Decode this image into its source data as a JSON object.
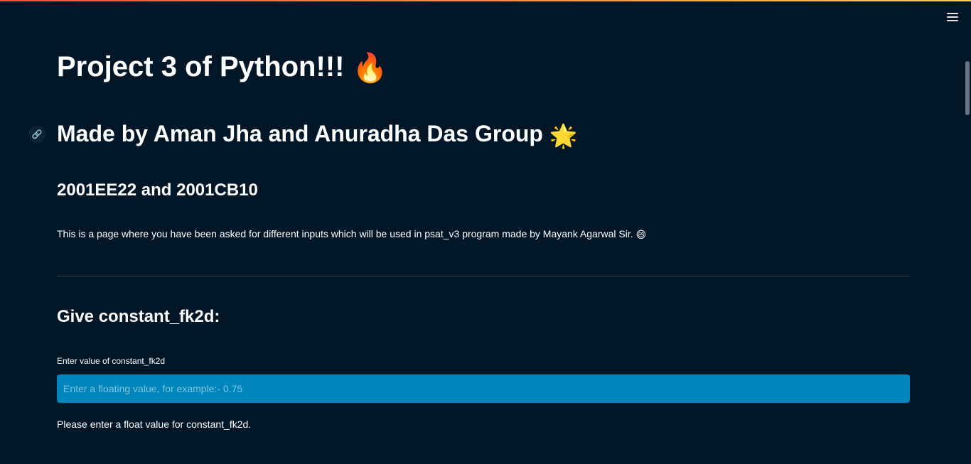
{
  "header": {
    "menu_icon": "hamburger-menu-icon"
  },
  "main": {
    "title": "Project 3 of Python!!!",
    "title_emoji": "🔥",
    "subtitle": "Made by Aman Jha and Anuradha Das Group",
    "subtitle_emoji": "🌟",
    "anchor_icon": "link-icon",
    "roll_numbers": "2001EE22 and 2001CB10",
    "description": "This is a page where you have been asked for different inputs which will be used in psat_v3 program made by Mayank Agarwal Sir.",
    "description_emoji": "😄"
  },
  "form": {
    "heading": "Give constant_fk2d:",
    "label": "Enter value of constant_fk2d",
    "placeholder": "Enter a floating value, for example:- 0.75",
    "value": "",
    "help_text": "Please enter a float value for constant_fk2d."
  },
  "colors": {
    "background": "#011627",
    "input_background": "#0086bd",
    "accent": "#ff4b4b"
  }
}
